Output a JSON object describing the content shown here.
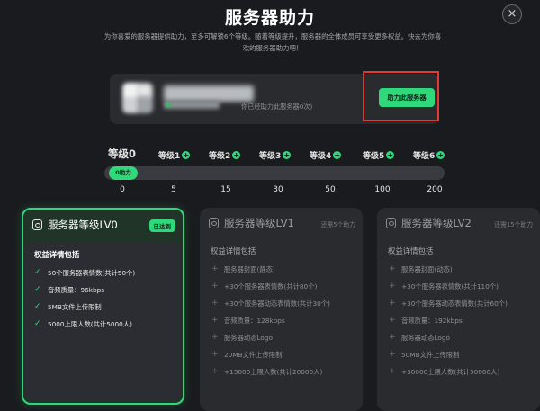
{
  "dialog": {
    "title": "服务器助力",
    "close_label": "×",
    "description": "为你喜爱的服务器提供助力，至多可解锁6个等级。随着等级提升，服务器的全体成员可享受更多权益。快去为你喜欢的服务器助力吧！"
  },
  "server": {
    "name": "",
    "boost_status": "你已经助力此服务器0次)",
    "boost_button_label": "助力此服务器"
  },
  "levels": {
    "current_label": "等级0",
    "items": [
      {
        "label": "等级1",
        "plus": "+"
      },
      {
        "label": "等级2",
        "plus": "+"
      },
      {
        "label": "等级3",
        "plus": "+"
      },
      {
        "label": "等级4",
        "plus": "+"
      },
      {
        "label": "等级5",
        "plus": "+"
      },
      {
        "label": "等级6",
        "plus": "+"
      }
    ],
    "progress_label": "0助力",
    "progress_fraction": 0.0,
    "ticks": [
      "0",
      "5",
      "15",
      "30",
      "50",
      "100",
      "200"
    ]
  },
  "cards": [
    {
      "title": "服务器等级LV0",
      "badge": "已达到",
      "perk_heading": "权益详情包括",
      "perks": [
        "50个服务器表情数(共计50个)",
        "音频质量：96kbps",
        "5MB文件上传限制",
        "5000上限人数(共计5000人)"
      ]
    },
    {
      "title": "服务器等级LV1",
      "requirement": "还需5个助力",
      "perk_heading": "权益详情包括",
      "perks": [
        "服务器封面(静态)",
        "+30个服务器表情数(共计80个)",
        "+30个服务器动态表情数(共计30个)",
        "音频质量：128kbps",
        "服务器动态Logo",
        "20MB文件上传限制",
        "+15000上限人数(共计20000人)"
      ]
    },
    {
      "title": "服务器等级LV2",
      "requirement": "还需15个助力",
      "perk_heading": "权益详情包括",
      "perks": [
        "服务器封面(动态)",
        "+30个服务器表情数(共计110个)",
        "+30个服务器动态表情数(共计60个)",
        "音频质量：192kbps",
        "服务器动态Logo",
        "50MB文件上传限制",
        "+30000上限人数(共计50000人)"
      ]
    }
  ],
  "colors": {
    "accent": "#2ed87b",
    "highlight": "#e23a37",
    "background": "#1a1b1e"
  }
}
